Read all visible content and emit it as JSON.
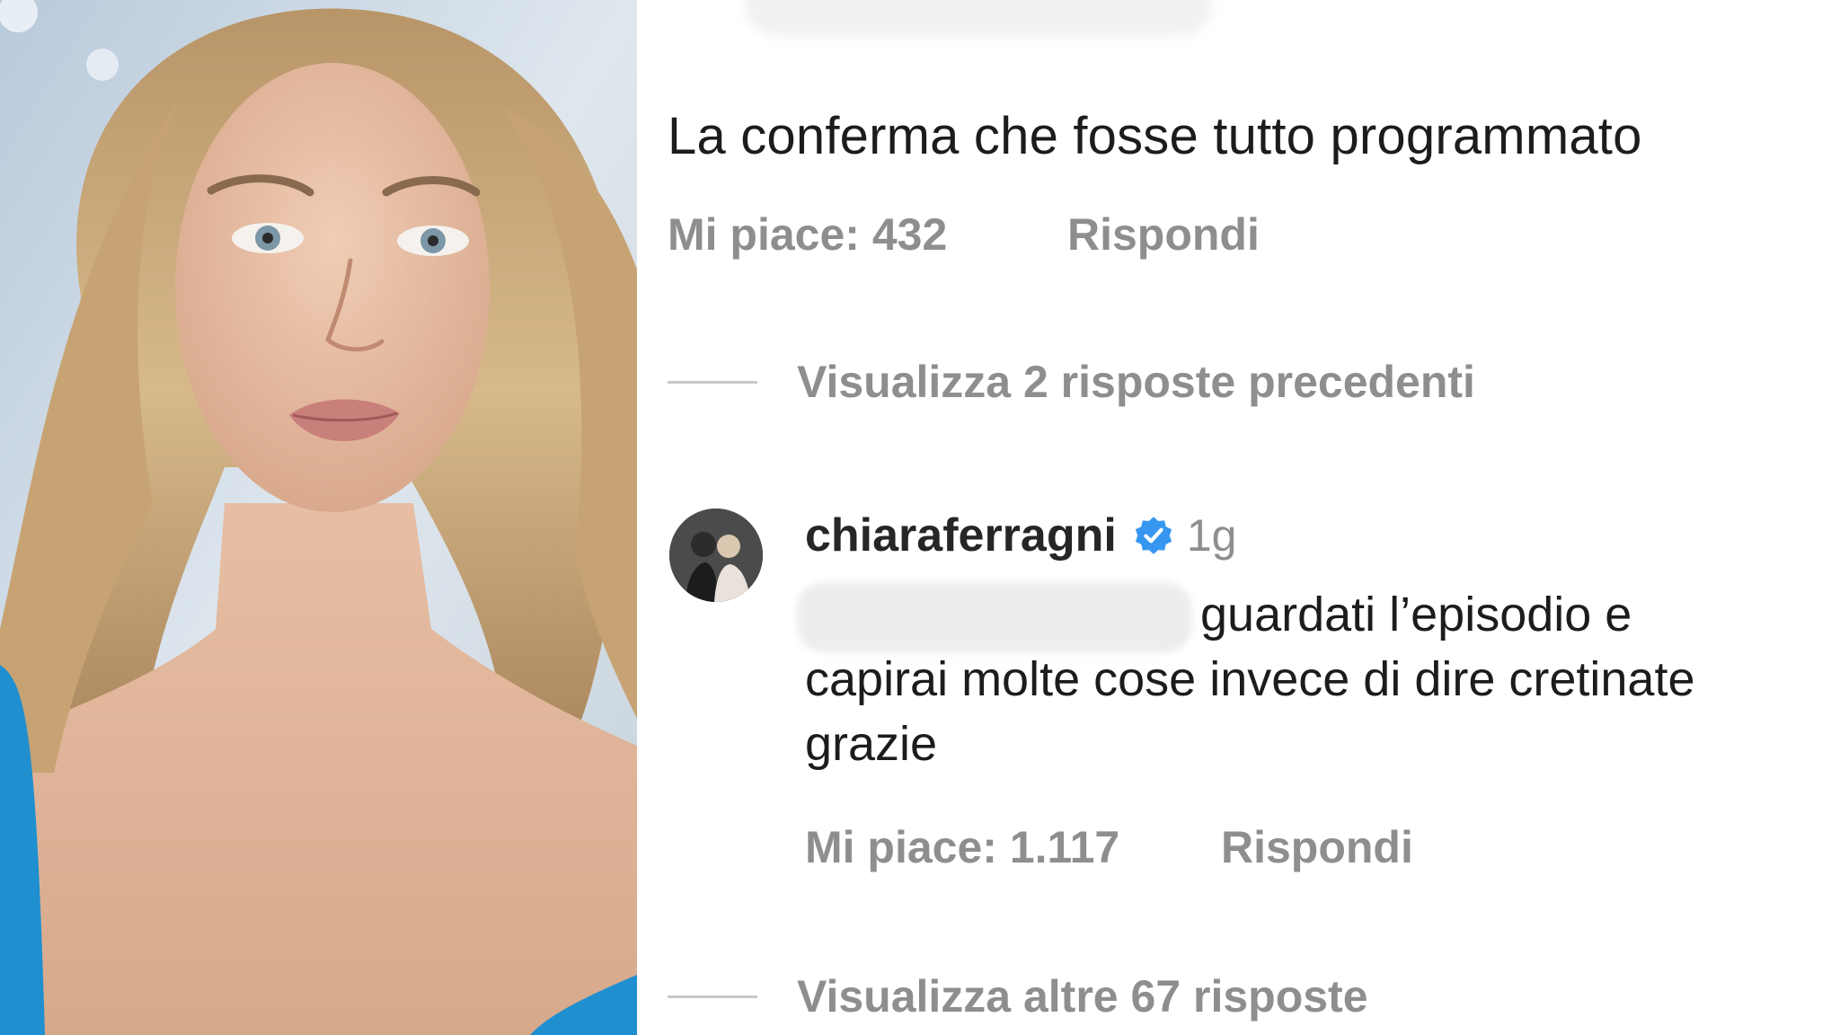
{
  "photo": {
    "icon": "portrait-photo",
    "colors": {
      "hair": "#c9a878",
      "skin": "#e9c2a8",
      "dress": "#1f8fd0",
      "background": "#cdd9e4"
    }
  },
  "parent_comment": {
    "text": "La conferma che fosse tutto programmato",
    "likes_label": "Mi piace: 432",
    "reply_label": "Rispondi"
  },
  "view_previous_replies": "Visualizza 2 risposte precedenti",
  "reply": {
    "username": "chiaraferragni",
    "verified_icon": "verified-badge-icon",
    "time": "1g",
    "text": "guardati l’episodio e capirai molte cose invece di dire cretinate grazie",
    "likes_label": "Mi piace: 1.117",
    "reply_label": "Rispondi"
  },
  "view_more_replies": "Visualizza altre 67 risposte",
  "colors": {
    "text": "#1c1c1c",
    "muted": "#8e8e8e",
    "verified": "#3797f0"
  }
}
